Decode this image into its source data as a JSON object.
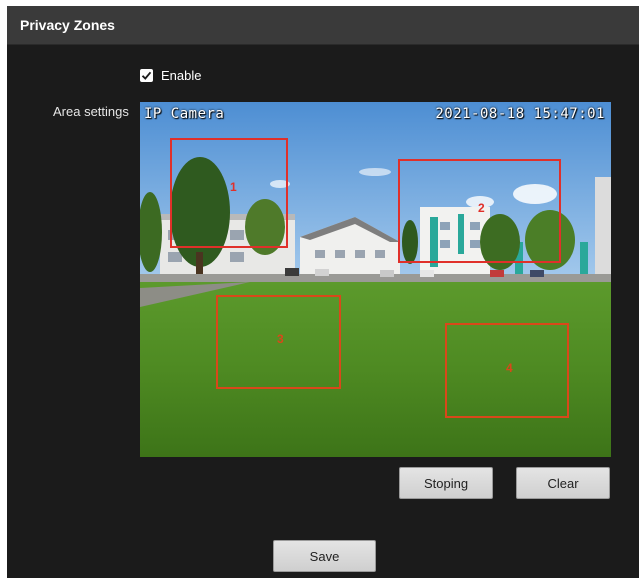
{
  "header": {
    "title": "Privacy Zones"
  },
  "enable": {
    "label": "Enable",
    "checked": true
  },
  "area_settings": {
    "label": "Area settings"
  },
  "video": {
    "osd_camera_name": "IP Camera",
    "osd_timestamp": "2021-08-18 15:47:01"
  },
  "zones": [
    {
      "number": "1",
      "color": "#e0302a"
    },
    {
      "number": "2",
      "color": "#e0302a"
    },
    {
      "number": "3",
      "color": "#d9481a"
    },
    {
      "number": "4",
      "color": "#d9481a"
    }
  ],
  "buttons": {
    "stop": "Stoping",
    "clear": "Clear",
    "save": "Save"
  }
}
